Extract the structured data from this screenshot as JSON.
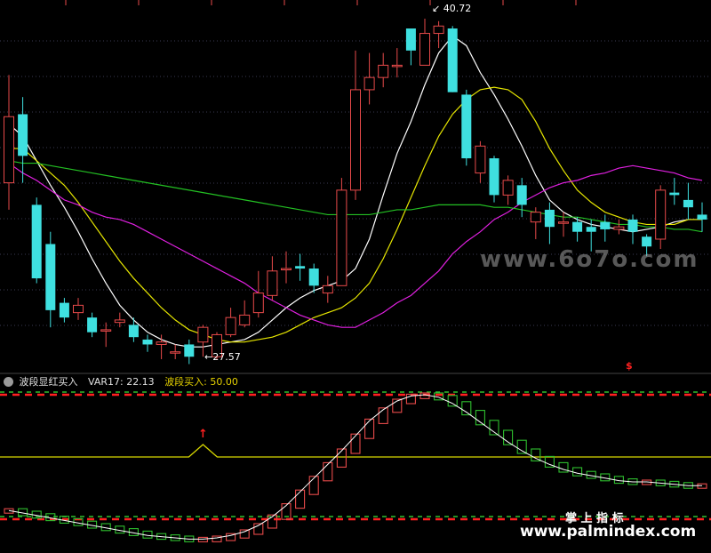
{
  "chart_data": [
    {
      "type": "candlestick",
      "annotations": {
        "high_label": "40.72",
        "low_label": "27.57"
      },
      "candles": [
        [
          34.1,
          36.8,
          38.5,
          33.0
        ],
        [
          36.9,
          35.2,
          37.6,
          34.1
        ],
        [
          33.2,
          30.2,
          33.5,
          30.0
        ],
        [
          31.6,
          28.9,
          32.1,
          28.2
        ],
        [
          29.2,
          28.6,
          29.4,
          28.4
        ],
        [
          28.8,
          29.1,
          29.4,
          28.5
        ],
        [
          28.6,
          28.0,
          28.8,
          27.8
        ],
        [
          28.1,
          28.1,
          28.4,
          27.4
        ],
        [
          28.4,
          28.5,
          28.8,
          28.2
        ],
        [
          28.3,
          27.8,
          28.6,
          27.6
        ],
        [
          27.7,
          27.5,
          27.9,
          27.2
        ],
        [
          27.5,
          27.6,
          27.9,
          26.9
        ],
        [
          27.2,
          27.2,
          27.5,
          26.9
        ],
        [
          27.5,
          27.0,
          27.7,
          26.7
        ],
        [
          27.6,
          28.2,
          28.3,
          27.0
        ],
        [
          27.0,
          27.9,
          28.0,
          26.9
        ],
        [
          27.9,
          28.6,
          29.0,
          27.8
        ],
        [
          28.3,
          28.7,
          29.3,
          28.2
        ],
        [
          28.8,
          29.6,
          30.5,
          28.6
        ],
        [
          29.5,
          30.5,
          31.1,
          29.3
        ],
        [
          30.6,
          30.6,
          31.3,
          30.0
        ],
        [
          30.7,
          30.6,
          31.2,
          30.1
        ],
        [
          30.6,
          29.9,
          30.8,
          29.6
        ],
        [
          29.6,
          29.9,
          30.3,
          29.2
        ],
        [
          29.9,
          33.8,
          34.3,
          29.9
        ],
        [
          33.8,
          37.9,
          39.5,
          33.4
        ],
        [
          37.9,
          38.4,
          39.4,
          37.3
        ],
        [
          38.4,
          38.9,
          39.4,
          38.0
        ],
        [
          38.9,
          38.9,
          39.6,
          38.4
        ],
        [
          40.4,
          39.5,
          39.7,
          38.9
        ],
        [
          38.9,
          40.2,
          40.8,
          38.9
        ],
        [
          40.2,
          40.5,
          40.7,
          39.6
        ],
        [
          40.4,
          37.8,
          40.5,
          37.8
        ],
        [
          37.7,
          35.1,
          37.9,
          34.8
        ],
        [
          34.5,
          35.6,
          35.8,
          34.1
        ],
        [
          35.1,
          33.6,
          35.2,
          33.3
        ],
        [
          33.6,
          34.2,
          34.4,
          33.2
        ],
        [
          34.0,
          33.2,
          34.3,
          32.7
        ],
        [
          32.5,
          32.9,
          33.1,
          31.8
        ],
        [
          33.0,
          32.3,
          33.3,
          31.6
        ],
        [
          32.5,
          32.5,
          32.9,
          31.9
        ],
        [
          32.5,
          32.1,
          32.7,
          31.7
        ],
        [
          32.3,
          32.1,
          32.6,
          31.3
        ],
        [
          32.5,
          32.2,
          32.8,
          31.7
        ],
        [
          32.2,
          32.3,
          32.6,
          32.0
        ],
        [
          32.6,
          32.1,
          32.8,
          31.6
        ],
        [
          31.9,
          31.5,
          32.0,
          31.1
        ],
        [
          31.8,
          33.8,
          34.0,
          31.4
        ],
        [
          33.7,
          33.6,
          34.3,
          33.2
        ],
        [
          33.4,
          33.1,
          34.1,
          32.6
        ],
        [
          32.8,
          32.6,
          33.3,
          32.1
        ]
      ],
      "lines": [
        {
          "name": "ma_white",
          "color": "#ffffff",
          "values": [
            36.5,
            36.0,
            35.0,
            34.0,
            33.1,
            32.1,
            31.0,
            30.0,
            29.1,
            28.5,
            28.0,
            27.7,
            27.5,
            27.4,
            27.4,
            27.5,
            27.6,
            27.7,
            28.0,
            28.5,
            29.0,
            29.4,
            29.7,
            29.9,
            30.1,
            30.6,
            31.8,
            33.6,
            35.3,
            36.6,
            38.1,
            39.4,
            40.1,
            39.7,
            38.6,
            37.7,
            36.7,
            35.6,
            34.4,
            33.4,
            32.9,
            32.6,
            32.4,
            32.3,
            32.2,
            32.1,
            32.2,
            32.3,
            32.5,
            32.6,
            32.6
          ]
        },
        {
          "name": "ma_yellow",
          "color": "#e6e600",
          "values": [
            35.5,
            35.5,
            35.0,
            34.5,
            34.0,
            33.3,
            32.5,
            31.7,
            30.9,
            30.2,
            29.6,
            29.0,
            28.5,
            28.1,
            27.9,
            27.7,
            27.6,
            27.6,
            27.7,
            27.8,
            28.0,
            28.3,
            28.6,
            28.8,
            29.0,
            29.4,
            30.0,
            31.0,
            32.2,
            33.5,
            34.8,
            36.0,
            36.9,
            37.5,
            37.9,
            38.0,
            37.9,
            37.5,
            36.6,
            35.5,
            34.6,
            33.8,
            33.3,
            32.9,
            32.7,
            32.5,
            32.4,
            32.4,
            32.4,
            32.6,
            32.6
          ]
        },
        {
          "name": "ma_magenta",
          "color": "#e020e0",
          "values": [
            34.9,
            34.5,
            34.2,
            33.8,
            33.4,
            33.2,
            32.9,
            32.7,
            32.6,
            32.4,
            32.1,
            31.8,
            31.5,
            31.2,
            30.9,
            30.6,
            30.3,
            30.0,
            29.6,
            29.3,
            29.0,
            28.7,
            28.5,
            28.3,
            28.2,
            28.2,
            28.5,
            28.8,
            29.2,
            29.5,
            30.0,
            30.5,
            31.2,
            31.7,
            32.1,
            32.6,
            32.9,
            33.3,
            33.6,
            33.9,
            34.1,
            34.2,
            34.4,
            34.5,
            34.7,
            34.8,
            34.7,
            34.6,
            34.5,
            34.3,
            34.2
          ]
        },
        {
          "name": "ma_green",
          "color": "#23c023",
          "values": [
            35.0,
            34.9,
            34.9,
            34.8,
            34.7,
            34.6,
            34.5,
            34.4,
            34.3,
            34.2,
            34.1,
            34.0,
            33.9,
            33.8,
            33.7,
            33.6,
            33.5,
            33.4,
            33.3,
            33.2,
            33.1,
            33.0,
            32.9,
            32.8,
            32.8,
            32.8,
            32.8,
            32.9,
            33.0,
            33.0,
            33.1,
            33.2,
            33.2,
            33.2,
            33.2,
            33.1,
            33.1,
            33.0,
            32.9,
            32.8,
            32.7,
            32.7,
            32.6,
            32.5,
            32.4,
            32.4,
            32.3,
            32.3,
            32.2,
            32.2,
            32.1
          ]
        }
      ]
    },
    {
      "type": "indicator",
      "title": "波段显红买入",
      "var_label": "VAR17: 22.13",
      "buy_label": "波段买入: 50.00",
      "levels": [
        0,
        50,
        100
      ],
      "values": [
        7,
        5,
        3,
        1,
        -1,
        -3,
        -5,
        -7,
        -9,
        -11,
        -13,
        -14,
        -15,
        -16,
        -16,
        -15,
        -13,
        -10,
        -5,
        2,
        11,
        22,
        33,
        44,
        55,
        67,
        79,
        88,
        95,
        99,
        100,
        98,
        93,
        86,
        78,
        70,
        62,
        55,
        49,
        44,
        40,
        37,
        35,
        33,
        31,
        30,
        30,
        29,
        28,
        27,
        27
      ],
      "spike_index": 14,
      "spike_value": 60
    }
  ],
  "watermarks": {
    "site_gray": "www.6o7o.com",
    "brand_cn": "掌 上 指 标",
    "brand_url": "www.palmindex.com"
  },
  "colors": {
    "bg": "#000000",
    "up": "#e84a4a",
    "down": "#3fe0e0",
    "grid": "#3a3a52",
    "red_dash": "#ff2020",
    "green_dash": "#2fbf2f",
    "yellow": "#d8d800",
    "buy_arrow": "#ff2020"
  }
}
